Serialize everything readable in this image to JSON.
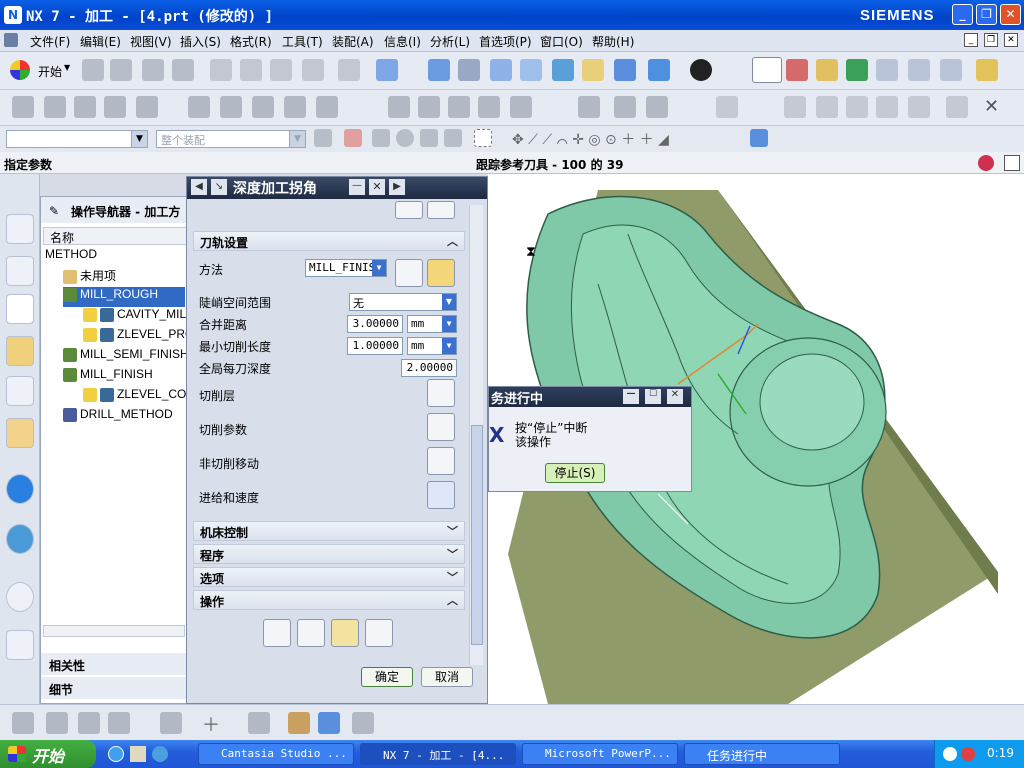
{
  "window": {
    "title": "NX 7 - 加工 - [4.prt  (修改的) ]",
    "brand": "SIEMENS",
    "controls": {
      "minimize": "_",
      "restore": "❐",
      "close": "✕"
    }
  },
  "menu": {
    "items": [
      "文件(F)",
      "编辑(E)",
      "视图(V)",
      "插入(S)",
      "格式(R)",
      "工具(T)",
      "装配(A)",
      "信息(I)",
      "分析(L)",
      "首选项(P)",
      "窗口(O)",
      "帮助(H)"
    ]
  },
  "toolbar": {
    "start_label": "开始",
    "assembly_filter": "整个装配"
  },
  "cue": {
    "prompt": "指定参数",
    "status": "跟踪参考刀具 - 100 的 39"
  },
  "navigator": {
    "title": "操作导航器 - 加工方",
    "column_name": "名称",
    "rows": [
      {
        "label": "METHOD",
        "indent": 0
      },
      {
        "label": "未用项",
        "indent": 1
      },
      {
        "label": "MILL_ROUGH",
        "indent": 1,
        "selected": true
      },
      {
        "label": "CAVITY_MIL",
        "indent": 2
      },
      {
        "label": "ZLEVEL_PRO",
        "indent": 2
      },
      {
        "label": "MILL_SEMI_FINISH",
        "indent": 1
      },
      {
        "label": "MILL_FINISH",
        "indent": 1
      },
      {
        "label": "ZLEVEL_COR",
        "indent": 2
      },
      {
        "label": "DRILL_METHOD",
        "indent": 1
      }
    ],
    "panel_related": "相关性",
    "panel_details": "细节"
  },
  "dialog": {
    "title": "深度加工拐角",
    "sections": {
      "toolpath": "刀轨设置",
      "machine": "机床控制",
      "program": "程序",
      "options": "选项",
      "operation": "操作"
    },
    "method_label": "方法",
    "method_value": "MILL_FINIS",
    "steep_label": "陡峭空间范围",
    "steep_value": "无",
    "merge_label": "合并距离",
    "merge_value": "3.00000",
    "merge_unit": "mm",
    "mincut_label": "最小切削长度",
    "mincut_value": "1.00000",
    "mincut_unit": "mm",
    "depth_label": "全局每刀深度",
    "depth_value": "2.00000",
    "cutlevels_label": "切削层",
    "cutparams_label": "切削参数",
    "noncut_label": "非切削移动",
    "feeds_label": "进给和速度",
    "ok": "确定",
    "cancel": "取消"
  },
  "progress": {
    "title": "务进行中",
    "message_line1": "按“停止”中断",
    "message_line2": "该操作",
    "stop_button": "停止(S)"
  },
  "taskbar": {
    "start": "开始",
    "tasks": [
      {
        "label": "Cantasia Studio ..."
      },
      {
        "label": "NX 7 - 加工 - [4..."
      },
      {
        "label": "Microsoft PowerP..."
      },
      {
        "label": "任务进行中"
      }
    ],
    "clock": "0:19"
  },
  "colors": {
    "title_bar": "#0a5fe6",
    "selection": "#316ac5",
    "part_green": "#7fc9a8",
    "base_plate": "#8f9c6a",
    "dialog_header": "#1e2a42"
  }
}
